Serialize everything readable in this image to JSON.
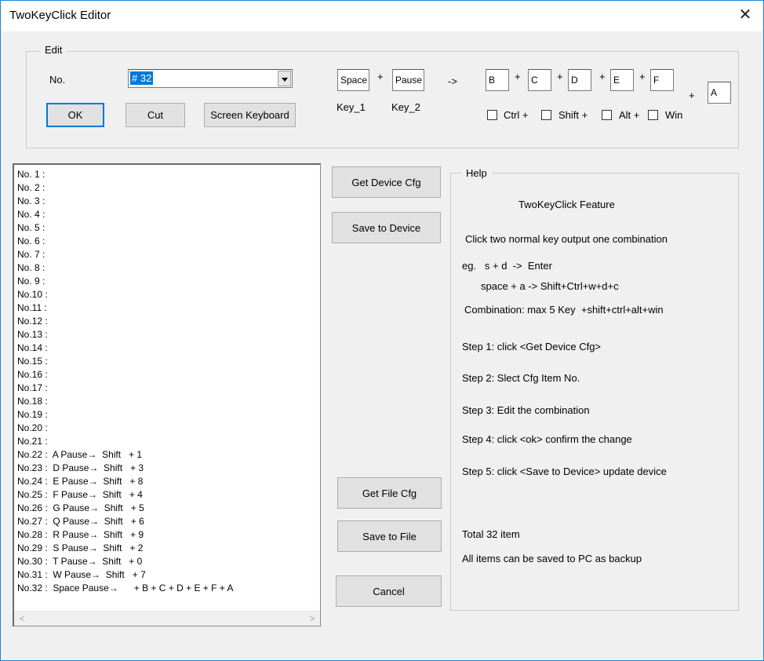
{
  "window": {
    "title": "TwoKeyClick Editor",
    "close_glyph": "✕"
  },
  "edit": {
    "legend": "Edit",
    "no_label": "No.",
    "no_selected": "# 32",
    "ok_label": "OK",
    "cut_label": "Cut",
    "screen_keyboard_label": "Screen Keyboard",
    "key1_value": "Space",
    "key2_value": "Pause",
    "plus": "+",
    "arrow": "->",
    "key1_label": "Key_1",
    "key2_label": "Key_2",
    "combo_keys": [
      "B",
      "C",
      "D",
      "E",
      "F"
    ],
    "extra_key": "A",
    "modifiers": {
      "ctrl": "Ctrl +",
      "shift": "Shift +",
      "alt": "Alt +",
      "win": "Win"
    }
  },
  "list": {
    "items": [
      "No. 1 :",
      "No. 2 :",
      "No. 3 :",
      "No. 4 :",
      "No. 5 :",
      "No. 6 :",
      "No. 7 :",
      "No. 8 :",
      "No. 9 :",
      "No.10 :",
      "No.11 :",
      "No.12 :",
      "No.13 :",
      "No.14 :",
      "No.15 :",
      "No.16 :",
      "No.17 :",
      "No.18 :",
      "No.19 :",
      "No.20 :",
      "No.21 :",
      "No.22 :  A Pause→  Shift   + 1",
      "No.23 :  D Pause→  Shift   + 3",
      "No.24 :  E Pause→  Shift   + 8",
      "No.25 :  F Pause→  Shift   + 4",
      "No.26 :  G Pause→  Shift   + 5",
      "No.27 :  Q Pause→  Shift   + 6",
      "No.28 :  R Pause→  Shift   + 9",
      "No.29 :  S Pause→  Shift   + 2",
      "No.30 :  T Pause→  Shift   + 0",
      "No.31 :  W Pause→  Shift   + 7",
      "No.32 :  Space Pause→      + B + C + D + E + F + A"
    ],
    "scroll_left": "<",
    "scroll_right": ">"
  },
  "buttons": {
    "get_device_cfg": "Get Device Cfg",
    "save_to_device": "Save to Device",
    "get_file_cfg": "Get File Cfg",
    "save_to_file": "Save to File",
    "cancel": "Cancel"
  },
  "help": {
    "legend": "Help",
    "feature_title": "TwoKeyClick Feature",
    "line1": "Click two normal key output one combination",
    "eg1": "eg.   s + d  ->  Enter",
    "eg2": "space + a -> Shift+Ctrl+w+d+c",
    "combination": "Combination: max 5 Key  +shift+ctrl+alt+win",
    "step1": "Step 1: click <Get Device Cfg>",
    "step2": "Step 2: Slect Cfg Item No.",
    "step3": "Step 3: Edit the combination",
    "step4": "Step 4: click <ok> confirm the change",
    "step5": "Step 5: click <Save to Device> update device",
    "total": "Total 32 item",
    "backup": "All items can be saved to PC as backup"
  }
}
